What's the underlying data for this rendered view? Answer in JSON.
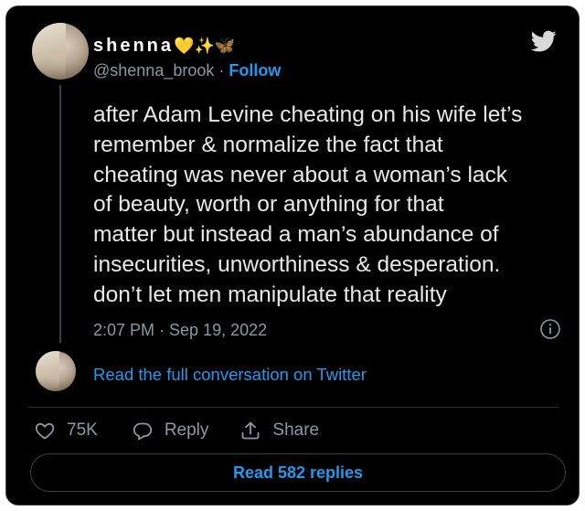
{
  "user": {
    "display_name": "shenna",
    "emoji": [
      "💛",
      "✨",
      "🦋"
    ],
    "handle": "@shenna_brook",
    "separator": " · ",
    "follow_label": "Follow"
  },
  "tweet": {
    "lines": [
      "after Adam Levine cheating on his wife let’s",
      "remember & normalize the fact that",
      "cheating was never about a woman’s lack",
      "of beauty, worth or anything for that",
      "matter but instead a man’s abundance of",
      "insecurities, unworthiness & desperation.",
      "don’t let men manipulate that reality"
    ],
    "timestamp": "2:07 PM · Sep 19, 2022"
  },
  "conversation_link": "Read the full conversation on Twitter",
  "actions": {
    "like_count": "75K",
    "reply_label": "Reply",
    "share_label": "Share"
  },
  "read_replies_label": "Read 582 replies",
  "icons": {
    "brand": "twitter-bird-icon",
    "info": "info-icon",
    "like": "heart-icon",
    "reply": "reply-bubble-icon",
    "share": "share-icon"
  },
  "colors": {
    "background": "#000000",
    "text": "#e7e9ea",
    "secondary": "#8b98a5",
    "accent": "#1d9bf0",
    "border": "#3a3f44"
  }
}
